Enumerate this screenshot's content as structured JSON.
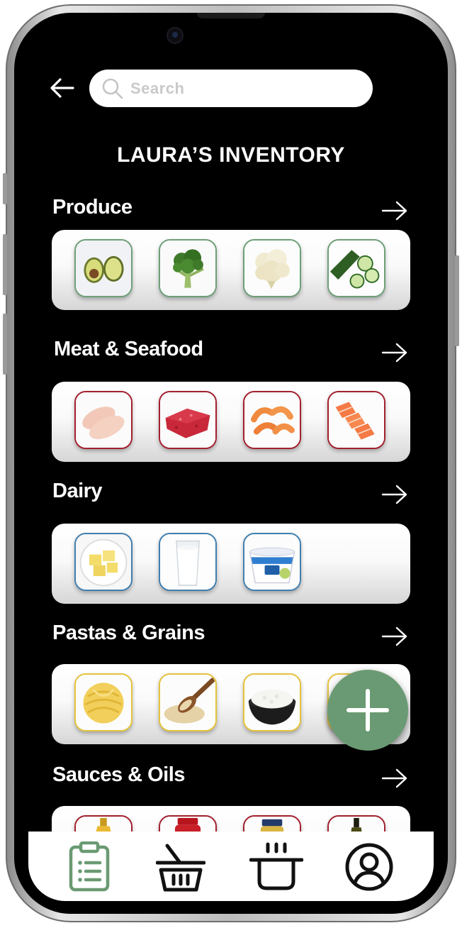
{
  "search": {
    "placeholder": "Search"
  },
  "page_title": "LAURA’S INVENTORY",
  "categories": [
    {
      "title": "Produce",
      "items": [
        "avocado",
        "broccoli",
        "cauliflower",
        "cucumber"
      ]
    },
    {
      "title": "Meat & Seafood",
      "items": [
        "chicken breast",
        "ground beef",
        "shrimp",
        "salmon"
      ]
    },
    {
      "title": "Dairy",
      "items": [
        "butter",
        "milk",
        "greek yogurt"
      ]
    },
    {
      "title": "Pastas & Grains",
      "items": [
        "fettuccine",
        "quinoa",
        "rice",
        "pasta"
      ]
    },
    {
      "title": "Sauces & Oils",
      "items": [
        "oil bottle",
        "tomato sauce jar",
        "jar",
        "oil bottle"
      ]
    }
  ],
  "colors": {
    "produce_border": "#6d9f78",
    "meat_border": "#a3202e",
    "dairy_border": "#3f7fb0",
    "grains_border": "#e5c33a",
    "sauces_border": "#a3202e",
    "accent_green": "#6a9a73",
    "background": "#000000"
  },
  "icons": {
    "back": "arrow-left-icon",
    "search": "magnifier-icon",
    "category_more": "arrow-right-icon",
    "add": "plus-icon",
    "tabs": [
      "clipboard-list-icon",
      "shopping-basket-icon",
      "cooking-pot-icon",
      "user-circle-icon"
    ]
  },
  "tabbar": {
    "active_tab": "inventory"
  }
}
